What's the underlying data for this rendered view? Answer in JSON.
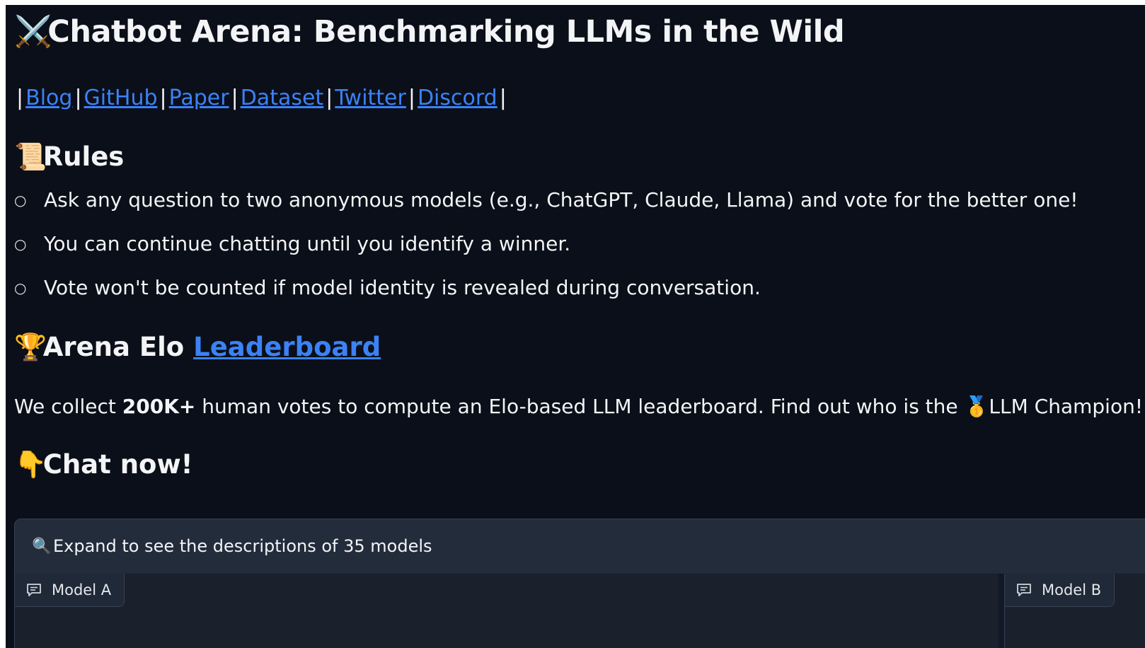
{
  "header": {
    "icon": "crossed-swords-icon",
    "title": "Chatbot Arena: Benchmarking LLMs in the Wild"
  },
  "links": [
    {
      "label": "Blog"
    },
    {
      "label": "GitHub"
    },
    {
      "label": "Paper"
    },
    {
      "label": "Dataset"
    },
    {
      "label": "Twitter"
    },
    {
      "label": "Discord"
    }
  ],
  "separator": "|",
  "rules": {
    "icon": "scroll-icon",
    "heading": "Rules",
    "items": [
      "Ask any question to two anonymous models (e.g., ChatGPT, Claude, Llama) and vote for the better one!",
      "You can continue chatting until you identify a winner.",
      "Vote won't be counted if model identity is revealed during conversation."
    ]
  },
  "elo": {
    "icon": "trophy-icon",
    "heading_text": "Arena Elo ",
    "leaderboard_link": "Leaderboard",
    "description_pre": "We collect ",
    "description_bold": "200K+",
    "description_mid": " human votes to compute an Elo-based LLM leaderboard. Find out who is the ",
    "description_post": "LLM Champion!",
    "medal_icon": "first-place-medal-icon"
  },
  "chat": {
    "icon": "pointing-down-icon",
    "heading": "Chat now!"
  },
  "models_panel": {
    "icon": "magnifier-icon",
    "expand_label": "Expand to see the descriptions of 35 models"
  },
  "chatbots": {
    "a_label": "Model A",
    "b_label": "Model B",
    "icon": "chat-bubble-icon"
  },
  "colors": {
    "background": "#0b0f19",
    "link": "#3b82f6",
    "panel": "#1f2937"
  }
}
